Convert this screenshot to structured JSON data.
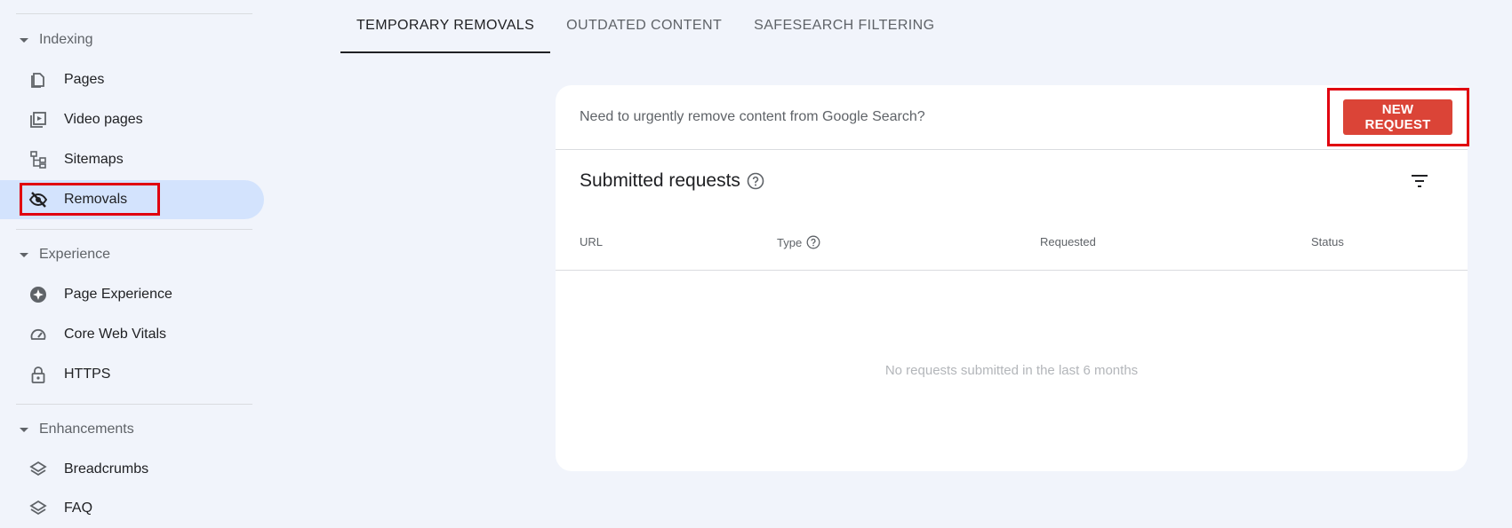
{
  "sidebar": {
    "sections": [
      {
        "label": "Indexing"
      },
      {
        "label": "Experience"
      },
      {
        "label": "Enhancements"
      }
    ],
    "items": [
      {
        "label": "Pages",
        "icon": "pages-icon"
      },
      {
        "label": "Video pages",
        "icon": "video-pages-icon"
      },
      {
        "label": "Sitemaps",
        "icon": "sitemaps-icon"
      },
      {
        "label": "Removals",
        "icon": "removals-icon",
        "active": true
      },
      {
        "label": "Page Experience",
        "icon": "page-experience-icon"
      },
      {
        "label": "Core Web Vitals",
        "icon": "core-web-vitals-icon"
      },
      {
        "label": "HTTPS",
        "icon": "lock-icon"
      },
      {
        "label": "Breadcrumbs",
        "icon": "breadcrumbs-icon"
      },
      {
        "label": "FAQ",
        "icon": "faq-icon"
      }
    ]
  },
  "tabs": [
    {
      "label": "TEMPORARY REMOVALS",
      "active": true
    },
    {
      "label": "OUTDATED CONTENT"
    },
    {
      "label": "SAFESEARCH FILTERING"
    }
  ],
  "card": {
    "banner_text": "Need to urgently remove content from Google Search?",
    "new_request_label": "NEW REQUEST",
    "title": "Submitted requests",
    "columns": [
      "URL",
      "Type",
      "Requested",
      "Status"
    ],
    "empty_message": "No requests submitted in the last 6 months"
  },
  "colors": {
    "accent_button": "#db4437",
    "active_nav_bg": "#d3e3fd",
    "highlight_border": "#e0000f",
    "page_bg": "#f1f4fb"
  }
}
